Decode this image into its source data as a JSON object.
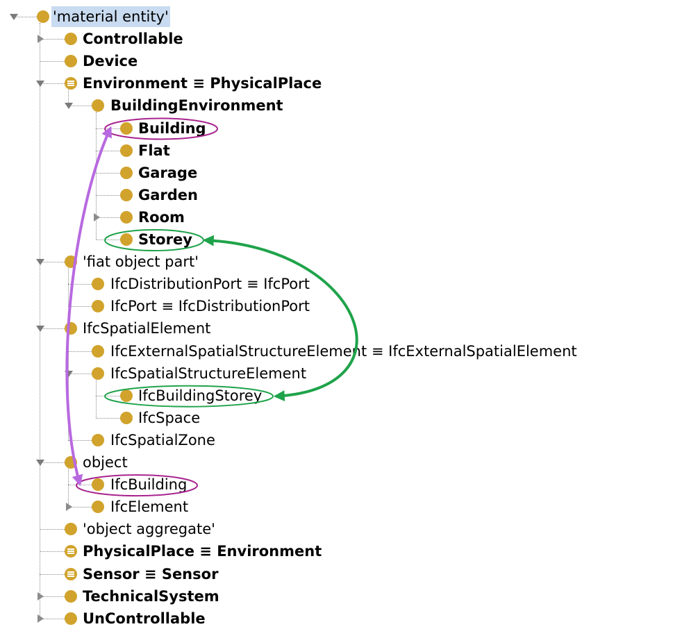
{
  "tree": {
    "rows": [
      {
        "label": "'material entity'",
        "bold": false,
        "equiv": false,
        "toggle": "expanded",
        "depth": 0,
        "selected": true
      },
      {
        "label": "Controllable",
        "bold": true,
        "equiv": false,
        "toggle": "collapsed",
        "depth": 1
      },
      {
        "label": "Device",
        "bold": true,
        "equiv": false,
        "toggle": "none",
        "depth": 1
      },
      {
        "label": "Environment ≡ PhysicalPlace",
        "bold": true,
        "equiv": true,
        "toggle": "expanded",
        "depth": 1
      },
      {
        "label": "BuildingEnvironment",
        "bold": true,
        "equiv": false,
        "toggle": "expanded",
        "depth": 2
      },
      {
        "label": "Building",
        "bold": true,
        "equiv": false,
        "toggle": "none",
        "depth": 3
      },
      {
        "label": "Flat",
        "bold": true,
        "equiv": false,
        "toggle": "none",
        "depth": 3
      },
      {
        "label": "Garage",
        "bold": true,
        "equiv": false,
        "toggle": "none",
        "depth": 3
      },
      {
        "label": "Garden",
        "bold": true,
        "equiv": false,
        "toggle": "none",
        "depth": 3
      },
      {
        "label": "Room",
        "bold": true,
        "equiv": false,
        "toggle": "collapsed",
        "depth": 3
      },
      {
        "label": "Storey",
        "bold": true,
        "equiv": false,
        "toggle": "none",
        "depth": 3
      },
      {
        "label": "'fiat object part'",
        "bold": false,
        "equiv": false,
        "toggle": "expanded",
        "depth": 1
      },
      {
        "label": "IfcDistributionPort ≡ IfcPort",
        "bold": false,
        "equiv": false,
        "toggle": "none",
        "depth": 2
      },
      {
        "label": "IfcPort ≡ IfcDistributionPort",
        "bold": false,
        "equiv": false,
        "toggle": "none",
        "depth": 2
      },
      {
        "label": "IfcSpatialElement",
        "bold": false,
        "equiv": false,
        "toggle": "expanded",
        "depth": 1
      },
      {
        "label": "IfcExternalSpatialStructureElement ≡ IfcExternalSpatialElement",
        "bold": false,
        "equiv": false,
        "toggle": "none",
        "depth": 2
      },
      {
        "label": "IfcSpatialStructureElement",
        "bold": false,
        "equiv": false,
        "toggle": "expanded",
        "depth": 2
      },
      {
        "label": "IfcBuildingStorey",
        "bold": false,
        "equiv": false,
        "toggle": "none",
        "depth": 3
      },
      {
        "label": "IfcSpace",
        "bold": false,
        "equiv": false,
        "toggle": "none",
        "depth": 3
      },
      {
        "label": "IfcSpatialZone",
        "bold": false,
        "equiv": false,
        "toggle": "none",
        "depth": 2
      },
      {
        "label": "object",
        "bold": false,
        "equiv": false,
        "toggle": "expanded",
        "depth": 1
      },
      {
        "label": "IfcBuilding",
        "bold": false,
        "equiv": false,
        "toggle": "none",
        "depth": 2
      },
      {
        "label": "IfcElement",
        "bold": false,
        "equiv": false,
        "toggle": "collapsed",
        "depth": 2
      },
      {
        "label": "'object aggregate'",
        "bold": false,
        "equiv": false,
        "toggle": "none",
        "depth": 1
      },
      {
        "label": "PhysicalPlace ≡ Environment",
        "bold": true,
        "equiv": true,
        "toggle": "none",
        "depth": 1
      },
      {
        "label": "Sensor ≡ Sensor",
        "bold": true,
        "equiv": true,
        "toggle": "none",
        "depth": 1
      },
      {
        "label": "TechnicalSystem",
        "bold": true,
        "equiv": false,
        "toggle": "collapsed",
        "depth": 1
      },
      {
        "label": "UnControllable",
        "bold": true,
        "equiv": false,
        "toggle": "collapsed",
        "depth": 1
      }
    ]
  },
  "annotations": {
    "purple_color": "#a8238e",
    "green_color": "#1fa34a",
    "purple_arrow_color": "#b869e0",
    "purple_link": [
      "Building",
      "IfcBuilding"
    ],
    "green_link": [
      "Storey",
      "IfcBuildingStorey"
    ]
  },
  "colors": {
    "class_icon": "#d1a32c",
    "selection": "#c9dbf0",
    "tree_lines": "#8a8a8a"
  }
}
